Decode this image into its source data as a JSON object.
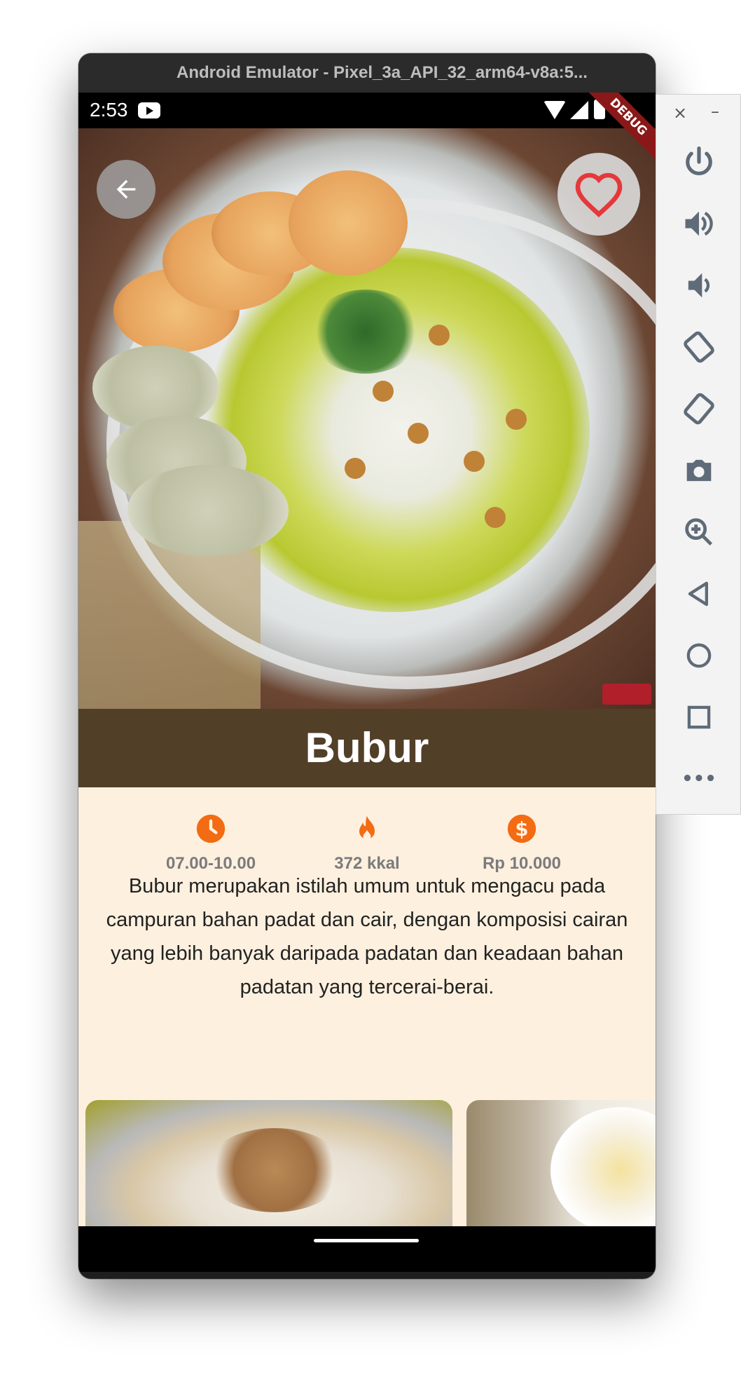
{
  "window": {
    "title": "Android Emulator - Pixel_3a_API_32_arm64-v8a:5..."
  },
  "status_bar": {
    "time": "2:53",
    "debug_banner": "DEBUG"
  },
  "detail": {
    "title": "Bubur",
    "stats": [
      {
        "icon": "clock-icon",
        "label": "07.00-10.00"
      },
      {
        "icon": "fire-icon",
        "label": "372 kkal"
      },
      {
        "icon": "dollar-icon",
        "label": "Rp 10.000"
      }
    ],
    "description": "Bubur merupakan istilah umum untuk mengacu pada campuran bahan padat dan cair, dengan komposisi cairan yang lebih banyak daripada padatan dan keadaan bahan padatan yang tercerai-berai."
  },
  "colors": {
    "accent": "#f36b12",
    "favorite": "#e5383b",
    "title_band": "#523f28",
    "page_bg": "#fdf0df"
  },
  "side_toolbar": {
    "close": "×",
    "minimize": "–",
    "buttons": [
      "power-icon",
      "volume-up-icon",
      "volume-down-icon",
      "rotate-left-icon",
      "rotate-right-icon",
      "camera-icon",
      "zoom-icon",
      "back-icon",
      "home-icon",
      "overview-icon",
      "more-icon"
    ],
    "more_label": "•••"
  }
}
